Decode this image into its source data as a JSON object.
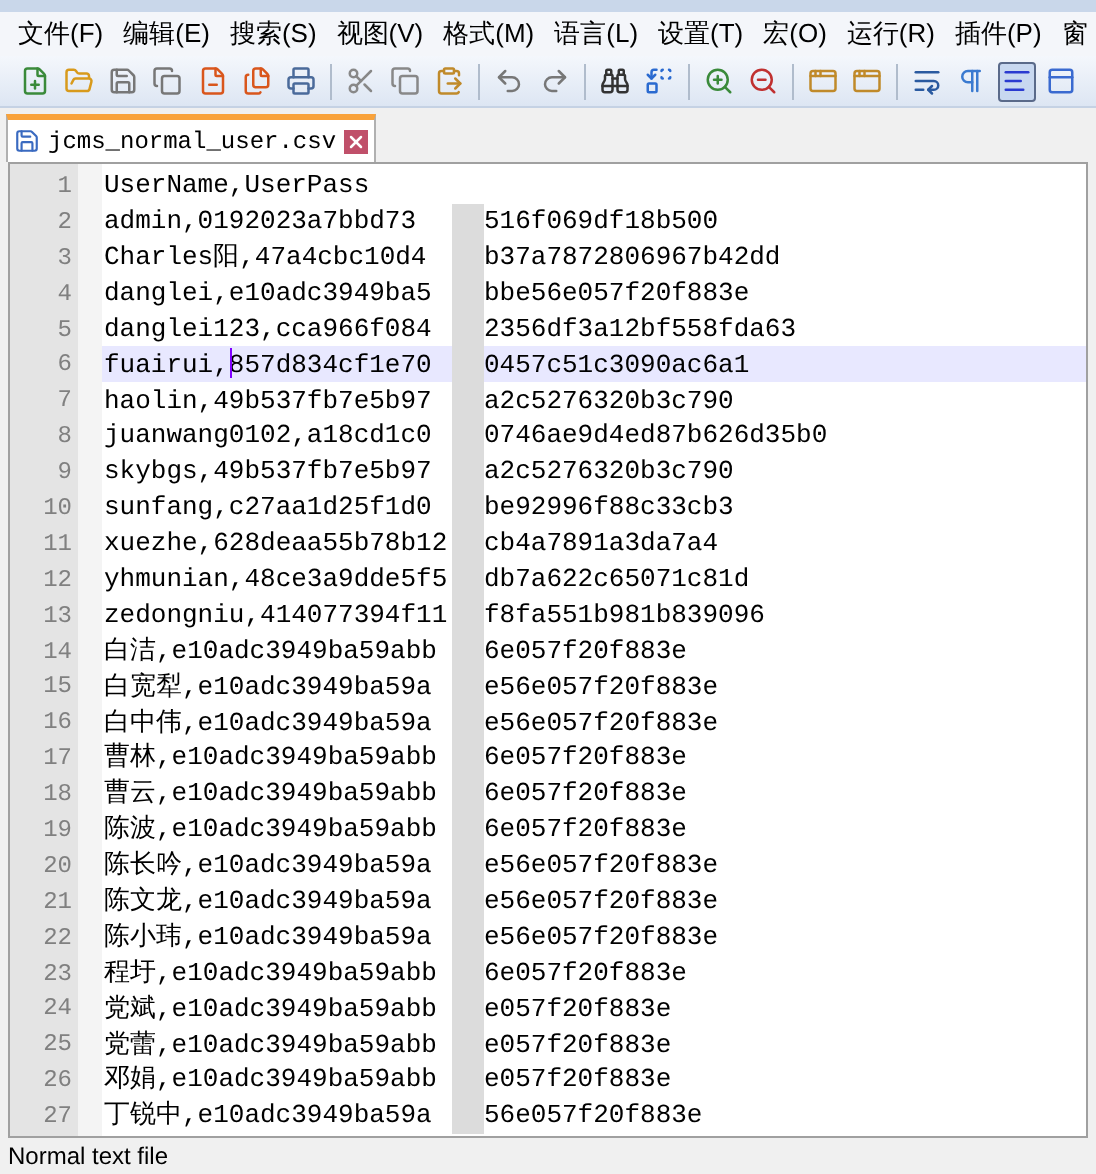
{
  "menu": [
    "文件(F)",
    "编辑(E)",
    "搜索(S)",
    "视图(V)",
    "格式(M)",
    "语言(L)",
    "设置(T)",
    "宏(O)",
    "运行(R)",
    "插件(P)",
    "窗"
  ],
  "toolbar": [
    {
      "kind": "new",
      "pressed": false
    },
    {
      "kind": "open",
      "pressed": false
    },
    {
      "kind": "save",
      "pressed": false
    },
    {
      "kind": "saveall",
      "pressed": false
    },
    {
      "kind": "close",
      "pressed": false
    },
    {
      "kind": "closeall",
      "pressed": false
    },
    {
      "kind": "print",
      "pressed": false
    },
    {
      "kind": "sep"
    },
    {
      "kind": "cut",
      "pressed": false
    },
    {
      "kind": "copy",
      "pressed": false
    },
    {
      "kind": "paste",
      "pressed": false
    },
    {
      "kind": "sep"
    },
    {
      "kind": "undo",
      "pressed": false
    },
    {
      "kind": "redo",
      "pressed": false
    },
    {
      "kind": "sep"
    },
    {
      "kind": "find",
      "pressed": false
    },
    {
      "kind": "replace",
      "pressed": false
    },
    {
      "kind": "sep"
    },
    {
      "kind": "zoomin",
      "pressed": false
    },
    {
      "kind": "zoomout",
      "pressed": false
    },
    {
      "kind": "sep"
    },
    {
      "kind": "sync",
      "pressed": false
    },
    {
      "kind": "sync",
      "pressed": false
    },
    {
      "kind": "sep"
    },
    {
      "kind": "wrap",
      "pressed": false
    },
    {
      "kind": "pilcrow",
      "pressed": false
    },
    {
      "kind": "indent",
      "pressed": true
    },
    {
      "kind": "window",
      "pressed": false
    }
  ],
  "tabs": [
    {
      "label": "jcms_normal_user.csv",
      "selected": true
    }
  ],
  "lines": [
    {
      "number": "1",
      "left": "UserName,UserPass",
      "redacted": false,
      "current": false
    },
    {
      "number": "2",
      "left": "admin,0192023a7bbd73",
      "right": "516f069df18b500",
      "redacted": true,
      "current": false
    },
    {
      "number": "3",
      "left": "Charles阳,47a4cbc10d4",
      "right": "b37a7872806967b42dd",
      "redacted": true,
      "current": false
    },
    {
      "number": "4",
      "left": "danglei,e10adc3949ba5",
      "right": "bbe56e057f20f883e",
      "redacted": true,
      "current": false
    },
    {
      "number": "5",
      "left": "danglei123,cca966f084",
      "right": "2356df3a12bf558fda63",
      "redacted": true,
      "current": false
    },
    {
      "number": "6",
      "left": "fuairui,857d834cf1e70",
      "right": "0457c51c3090ac6a1",
      "redacted": true,
      "current": true,
      "caret": true
    },
    {
      "number": "7",
      "left": "haolin,49b537fb7e5b97",
      "right": "a2c5276320b3c790",
      "redacted": true,
      "current": false
    },
    {
      "number": "8",
      "left": "juanwang0102,a18cd1c0",
      "right": "0746ae9d4ed87b626d35b0",
      "redacted": true,
      "current": false
    },
    {
      "number": "9",
      "left": "skybgs,49b537fb7e5b97",
      "right": "a2c5276320b3c790",
      "redacted": true,
      "current": false
    },
    {
      "number": "10",
      "left": "sunfang,c27aa1d25f1d0",
      "right": "be92996f88c33cb3",
      "redacted": true,
      "current": false
    },
    {
      "number": "11",
      "left": "xuezhe,628deaa55b78b12",
      "right": "cb4a7891a3da7a4",
      "redacted": true,
      "current": false
    },
    {
      "number": "12",
      "left": "yhmunian,48ce3a9dde5f5",
      "right": "db7a622c65071c81d",
      "redacted": true,
      "current": false
    },
    {
      "number": "13",
      "left": "zedongniu,414077394f11",
      "right": "f8fa551b981b839096",
      "redacted": true,
      "current": false
    },
    {
      "number": "14",
      "left": "白洁,e10adc3949ba59abb",
      "right": "6e057f20f883e",
      "redacted": true,
      "current": false
    },
    {
      "number": "15",
      "left": "白宽犁,e10adc3949ba59a",
      "right": "e56e057f20f883e",
      "redacted": true,
      "current": false
    },
    {
      "number": "16",
      "left": "白中伟,e10adc3949ba59a",
      "right": "e56e057f20f883e",
      "redacted": true,
      "current": false
    },
    {
      "number": "17",
      "left": "曹林,e10adc3949ba59abb",
      "right": "6e057f20f883e",
      "redacted": true,
      "current": false
    },
    {
      "number": "18",
      "left": "曹云,e10adc3949ba59abb",
      "right": "6e057f20f883e",
      "redacted": true,
      "current": false
    },
    {
      "number": "19",
      "left": "陈波,e10adc3949ba59abb",
      "right": "6e057f20f883e",
      "redacted": true,
      "current": false
    },
    {
      "number": "20",
      "left": "陈长吟,e10adc3949ba59a",
      "right": "e56e057f20f883e",
      "redacted": true,
      "current": false
    },
    {
      "number": "21",
      "left": "陈文龙,e10adc3949ba59a",
      "right": "e56e057f20f883e",
      "redacted": true,
      "current": false
    },
    {
      "number": "22",
      "left": "陈小玮,e10adc3949ba59a",
      "right": "e56e057f20f883e",
      "redacted": true,
      "current": false
    },
    {
      "number": "23",
      "left": "程圩,e10adc3949ba59abb",
      "right": "6e057f20f883e",
      "redacted": true,
      "current": false
    },
    {
      "number": "24",
      "left": "党斌,e10adc3949ba59abb",
      "right": "e057f20f883e",
      "redacted": true,
      "current": false
    },
    {
      "number": "25",
      "left": "党蕾,e10adc3949ba59abb",
      "right": "e057f20f883e",
      "redacted": true,
      "current": false
    },
    {
      "number": "26",
      "left": "邓娟,e10adc3949ba59abb",
      "right": "e057f20f883e",
      "redacted": true,
      "current": false
    },
    {
      "number": "27",
      "left": "丁锐中,e10adc3949ba59a",
      "right": "56e057f20f883e",
      "redacted": true,
      "current": false
    }
  ],
  "status_bar": "Normal text file"
}
